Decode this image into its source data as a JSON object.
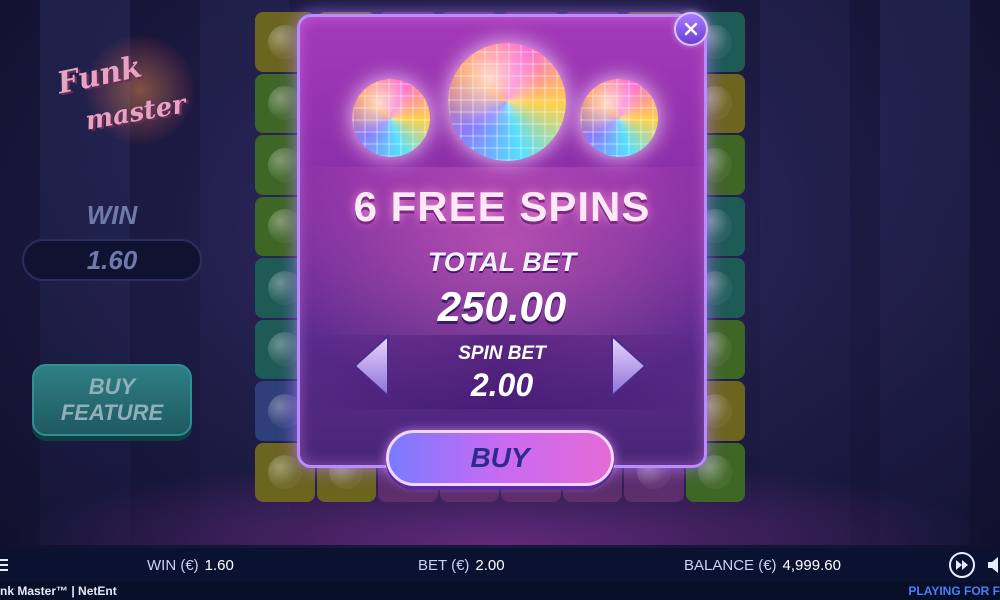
{
  "logo": {
    "line1": "Funk",
    "line2": "master"
  },
  "left_panel": {
    "win_label": "WIN",
    "win_value": "1.60",
    "buy_feature_line1": "BUY",
    "buy_feature_line2": "FEATURE"
  },
  "modal": {
    "title": "6 FREE SPINS",
    "total_bet_label": "TOTAL BET",
    "total_bet_value": "250.00",
    "spin_bet_label": "SPIN BET",
    "spin_bet_value": "2.00",
    "buy_label": "BUY",
    "close_icon": "close-icon",
    "decrease_icon": "arrow-left-icon",
    "increase_icon": "arrow-right-icon"
  },
  "bottom_bar": {
    "win_label": "WIN (€)",
    "win_value": "1.60",
    "bet_label": "BET (€)",
    "bet_value": "2.00",
    "balance_label": "BALANCE (€)",
    "balance_value": "4,999.60"
  },
  "footer": {
    "game_name": "nk Master™  |  NetEnt",
    "mode": "PLAYING FOR F"
  },
  "colors": {
    "modal_border": "#b88cff",
    "buy_button": "#c86af2",
    "accent_blue": "#4d7dff"
  }
}
